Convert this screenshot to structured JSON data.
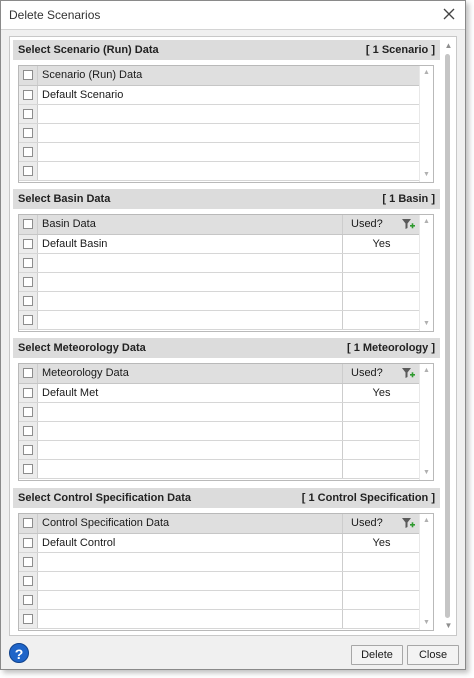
{
  "window": {
    "title": "Delete Scenarios"
  },
  "sections": [
    {
      "title": "Select Scenario (Run) Data",
      "count": "[ 1 Scenario ]",
      "column_header": "Scenario (Run) Data",
      "used_header": "",
      "rows": [
        {
          "name": "Default Scenario",
          "used": ""
        },
        {
          "name": "",
          "used": ""
        },
        {
          "name": "",
          "used": ""
        },
        {
          "name": "",
          "used": ""
        },
        {
          "name": "",
          "used": ""
        }
      ]
    },
    {
      "title": "Select Basin Data",
      "count": "[ 1 Basin ]",
      "column_header": "Basin Data",
      "used_header": "Used?",
      "rows": [
        {
          "name": "Default Basin",
          "used": "Yes"
        },
        {
          "name": "",
          "used": ""
        },
        {
          "name": "",
          "used": ""
        },
        {
          "name": "",
          "used": ""
        },
        {
          "name": "",
          "used": ""
        }
      ]
    },
    {
      "title": "Select Meteorology Data",
      "count": "[ 1 Meteorology ]",
      "column_header": "Meteorology Data",
      "used_header": "Used?",
      "rows": [
        {
          "name": "Default Met",
          "used": "Yes"
        },
        {
          "name": "",
          "used": ""
        },
        {
          "name": "",
          "used": ""
        },
        {
          "name": "",
          "used": ""
        },
        {
          "name": "",
          "used": ""
        }
      ]
    },
    {
      "title": "Select Control Specification Data",
      "count": "[ 1 Control Specification ]",
      "column_header": "Control Specification Data",
      "used_header": "Used?",
      "rows": [
        {
          "name": "Default Control",
          "used": "Yes"
        },
        {
          "name": "",
          "used": ""
        },
        {
          "name": "",
          "used": ""
        },
        {
          "name": "",
          "used": ""
        },
        {
          "name": "",
          "used": ""
        }
      ]
    }
  ],
  "footer": {
    "delete_label": "Delete",
    "close_label": "Close",
    "help_label": "?"
  },
  "icons": {
    "close": "close-icon",
    "help": "help-icon",
    "filter": "filter-add-icon"
  }
}
